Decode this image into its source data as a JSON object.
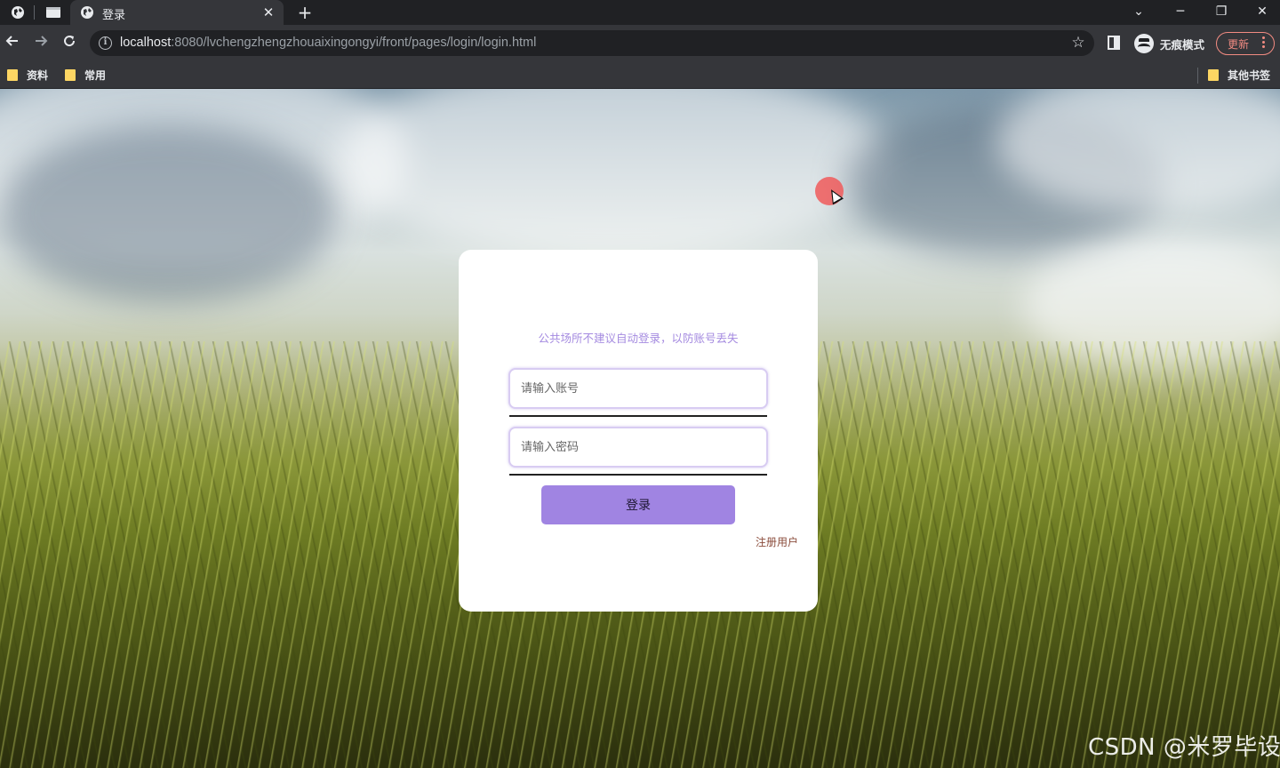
{
  "browser": {
    "tab_title": "登录",
    "new_tab_symbol": "+",
    "tab_close_symbol": "✕",
    "url_host": "localhost",
    "url_rest": ":8080/lvchengzhengzhouaixingongyi/front/pages/login/login.html",
    "incognito_label": "无痕模式",
    "update_label": "更新",
    "window_controls": {
      "minimize": "─",
      "restore": "❐",
      "close": "✕",
      "tab_search": "⌄"
    },
    "bookmarks": [
      {
        "label": "资料"
      },
      {
        "label": "常用"
      }
    ],
    "other_bookmarks_label": "其他书签"
  },
  "login": {
    "tip": "公共场所不建议自动登录，以防账号丢失",
    "account_placeholder": "请输入账号",
    "password_placeholder": "请输入密码",
    "submit_label": "登录",
    "register_label": "注册用户"
  },
  "watermark": "CSDN @米罗毕设",
  "colors": {
    "accent": "#a084e2",
    "tip_text": "#a58be0",
    "register_link": "#8a4b3a",
    "update_badge": "#f28b82"
  }
}
